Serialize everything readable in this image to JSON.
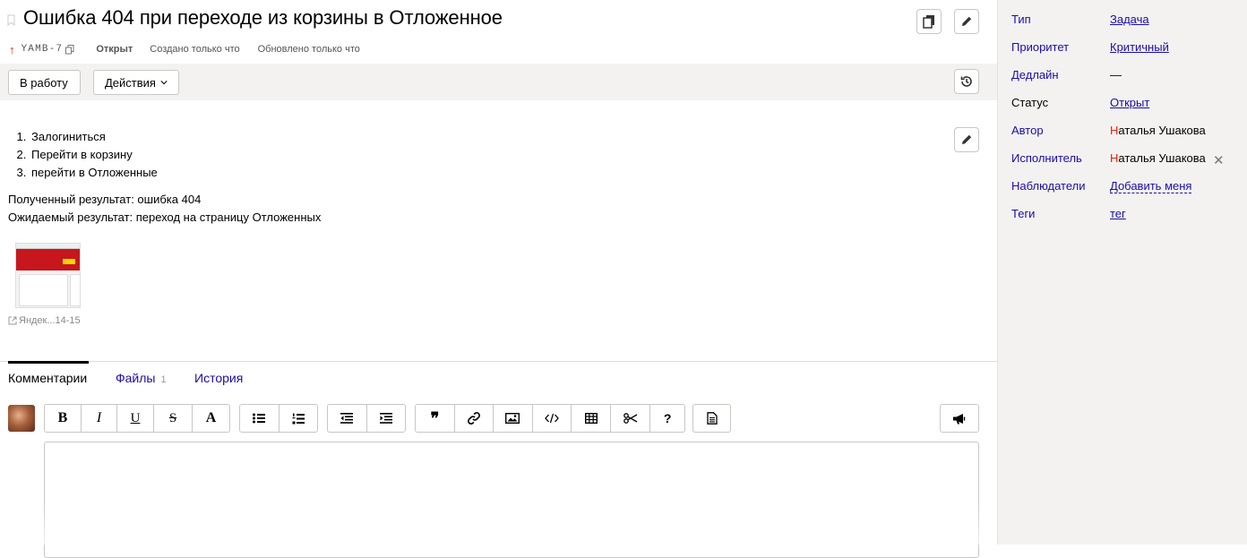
{
  "issue": {
    "title": "Ошибка 404 при переходе из корзины в Отложенное",
    "priority_arrow": "↑",
    "key": "YAMB-7",
    "status": "Открыт",
    "created": "Создано только что",
    "updated": "Обновлено только что"
  },
  "toolbar": {
    "work_label": "В работу",
    "actions_label": "Действия"
  },
  "description": {
    "steps": [
      "Залогиниться",
      "Перейти в корзину",
      "перейти в Отложенные"
    ],
    "actual": "Полученный результат: ошибка 404",
    "expected": "Ожидаемый результат: переход на страницу Отложенных"
  },
  "attachment": {
    "label": "Яндек...14-15"
  },
  "tabs": [
    {
      "label": "Комментарии"
    },
    {
      "label": "Файлы",
      "count": "1"
    },
    {
      "label": "История"
    }
  ],
  "sidebar": {
    "type_label": "Тип",
    "type_value": "Задача",
    "priority_label": "Приоритет",
    "priority_value": "Критичный",
    "deadline_label": "Дедлайн",
    "deadline_value": "—",
    "status_label": "Статус",
    "status_value": "Открыт",
    "author_label": "Автор",
    "author_first": "Н",
    "author_rest": "аталья Ушакова",
    "assignee_label": "Исполнитель",
    "assignee_first": "Н",
    "assignee_rest": "аталья Ушакова",
    "watchers_label": "Наблюдатели",
    "watchers_value": "Добавить меня",
    "tags_label": "Теги",
    "tags_value": "тег"
  },
  "editor_toolbar": {
    "bold": "B",
    "italic": "I",
    "underline": "U",
    "strike": "S",
    "font": "A",
    "quote": "❞",
    "help": "?"
  },
  "colors": {
    "accent_link": "#1a0dab",
    "priority_red": "#e0230b",
    "sidebar_bg": "#f3f2f1"
  }
}
